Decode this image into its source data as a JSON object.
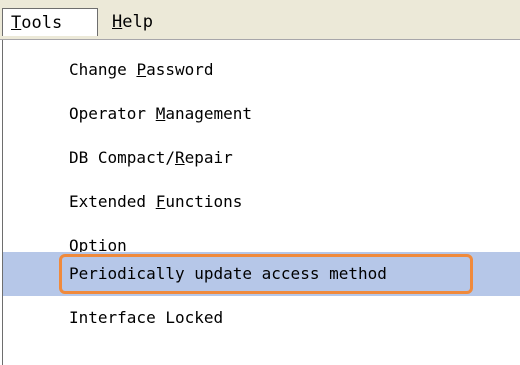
{
  "menubar": {
    "tools": {
      "prefix": "",
      "accel": "T",
      "suffix": "ools"
    },
    "help": {
      "prefix": "",
      "accel": "H",
      "suffix": "elp"
    }
  },
  "menu": {
    "items": [
      {
        "prefix": "Change ",
        "accel": "P",
        "suffix": "assword"
      },
      {
        "prefix": "Operator ",
        "accel": "M",
        "suffix": "anagement"
      },
      {
        "prefix": "DB Compact/",
        "accel": "R",
        "suffix": "epair"
      },
      {
        "prefix": "Extended ",
        "accel": "F",
        "suffix": "unctions"
      },
      {
        "prefix": "Option",
        "accel": "",
        "suffix": ""
      },
      {
        "prefix": "Periodically update access method",
        "accel": "",
        "suffix": ""
      },
      {
        "prefix": "Interface Locked",
        "accel": "",
        "suffix": ""
      }
    ],
    "selected_index": 5
  },
  "colors": {
    "selection": "#b6c7e8",
    "highlight_outline": "#f08a3c",
    "menubar_bg": "#ece9d8"
  }
}
